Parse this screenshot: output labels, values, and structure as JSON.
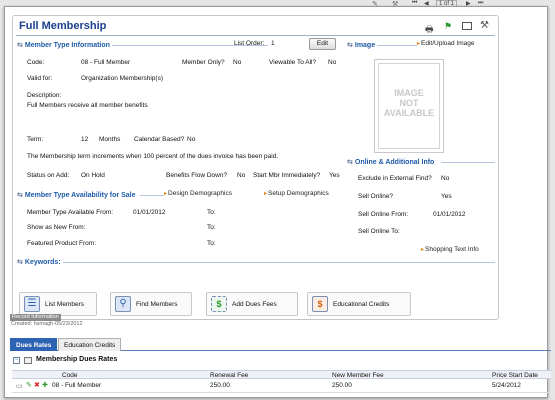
{
  "header": {
    "title": "Full Membership",
    "pager": "1 of 1",
    "list_order_label": "List Order:",
    "list_order_value": "1",
    "edit_label": "Edit"
  },
  "member_type_info": {
    "heading": "Member Type Information",
    "code_label": "Code:",
    "code_value": "08 - Full Member",
    "member_only_label": "Member Only?",
    "member_only_value": "No",
    "viewable_label": "Viewable To All?",
    "viewable_value": "No",
    "valid_for_label": "Valid for:",
    "valid_for_value": "Organization Membership(s)",
    "description_label": "Description:",
    "description_value": "Full Members receive all member benefits",
    "term_label": "Term:",
    "term_value": "12",
    "term_unit": "Months",
    "calendar_based_label": "Calendar Based?",
    "calendar_based_value": "No",
    "term_increment_text": "The Membership term increments when 100   percent of the dues invoice has been paid.",
    "status_on_add_label": "Status on Add:",
    "status_on_add_value": "On Hold",
    "benefits_flow_label": "Benefits Flow Down?",
    "benefits_flow_value": "No",
    "start_mbr_label": "Start Mbr Immediately?",
    "start_mbr_value": "Yes"
  },
  "image_section": {
    "heading": "Image",
    "edit_link": "Edit/Upload Image",
    "placeholder": "IMAGE\nNOT\nAVAILABLE"
  },
  "online_section": {
    "heading": "Online & Additional Info",
    "exclude_label": "Exclude in External Find?",
    "exclude_value": "No",
    "sell_online_label": "Sell Online?",
    "sell_online_value": "Yes",
    "sell_from_label": "Sell Online From:",
    "sell_from_value": "01/01/2012",
    "sell_to_label": "Sell Online To:",
    "sell_to_value": "",
    "shopping_link": "Shopping Text Info"
  },
  "availability": {
    "heading": "Member Type Availability for Sale",
    "design_link": "Design Demographics",
    "setup_link": "Setup Demographics",
    "available_from_label": "Member Type Available From:",
    "available_from_value": "01/01/2012",
    "to_label": "To:",
    "show_new_label": "Show as New From:",
    "featured_label": "Featured Product From:"
  },
  "keywords": {
    "heading": "Keywords:"
  },
  "actions": [
    {
      "label": "List Members",
      "icon": "list-members-icon"
    },
    {
      "label": "Find Members",
      "icon": "find-members-icon"
    },
    {
      "label": "Add Dues Fees",
      "icon": "add-dues-fees-icon"
    },
    {
      "label": "Educational Credits",
      "icon": "educational-credits-icon"
    }
  ],
  "record_info": {
    "heading": "Record Information",
    "created": "Created: hsmagh-05/23/2012"
  },
  "tabs": [
    {
      "label": "Dues Rates",
      "active": true
    },
    {
      "label": "Education Credits",
      "active": false
    }
  ],
  "dues_grid": {
    "title": "Membership Dues Rates",
    "columns": [
      "Code",
      "Renewal Fee",
      "New Member Fee",
      "Price Start Date"
    ],
    "rows": [
      {
        "code": "08 - Full Member",
        "renewal_fee": "250.00",
        "new_member_fee": "250.00",
        "start_date": "5/24/2012"
      }
    ]
  },
  "colors": {
    "accent": "#1e5aa6",
    "tab_active": "#2d63b3",
    "link_arrow": "#e07b00"
  }
}
